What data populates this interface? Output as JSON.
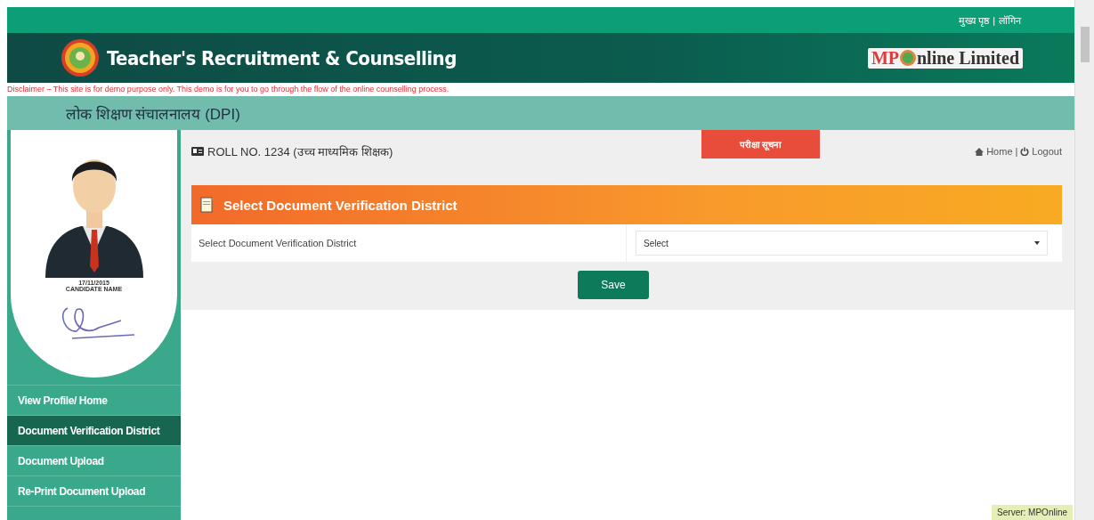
{
  "top_links": [
    "मुख्य पृष्ठ",
    "लॉगिन"
  ],
  "top_separator": "|",
  "header": {
    "title": "Teacher's Recruitment & Counselling",
    "partner_logo": {
      "prefix": "MP",
      "suffix": "nline Limited"
    }
  },
  "disclaimer": "Disclaimer – This site is for demo purpose only. This demo is for you to go through the flow of the online counselling process.",
  "department": "लोक शिक्षण संचालनालय (DPI)",
  "profile": {
    "date": "17/11/2015",
    "name": "CANDIDATE NAME"
  },
  "sidebar": {
    "items": [
      {
        "label": "View Profile/ Home",
        "selected": false
      },
      {
        "label": "Document Verification District",
        "selected": true
      },
      {
        "label": "Document Upload",
        "selected": false
      },
      {
        "label": "Re-Print Document Upload",
        "selected": false
      }
    ]
  },
  "toolbar": {
    "roll": "ROLL NO. 1234 (उच्च माध्यमिक शिक्षक)",
    "notice_button": "परीक्षा सूचना",
    "home_link": "Home",
    "link_separator": "|",
    "logout_link": "Logout"
  },
  "panel": {
    "title": "Select Document Verification District",
    "field_label": "Select Document Verification District",
    "select_value": "Select",
    "save_button": "Save"
  },
  "server_badge": "Server: MPOnline"
}
